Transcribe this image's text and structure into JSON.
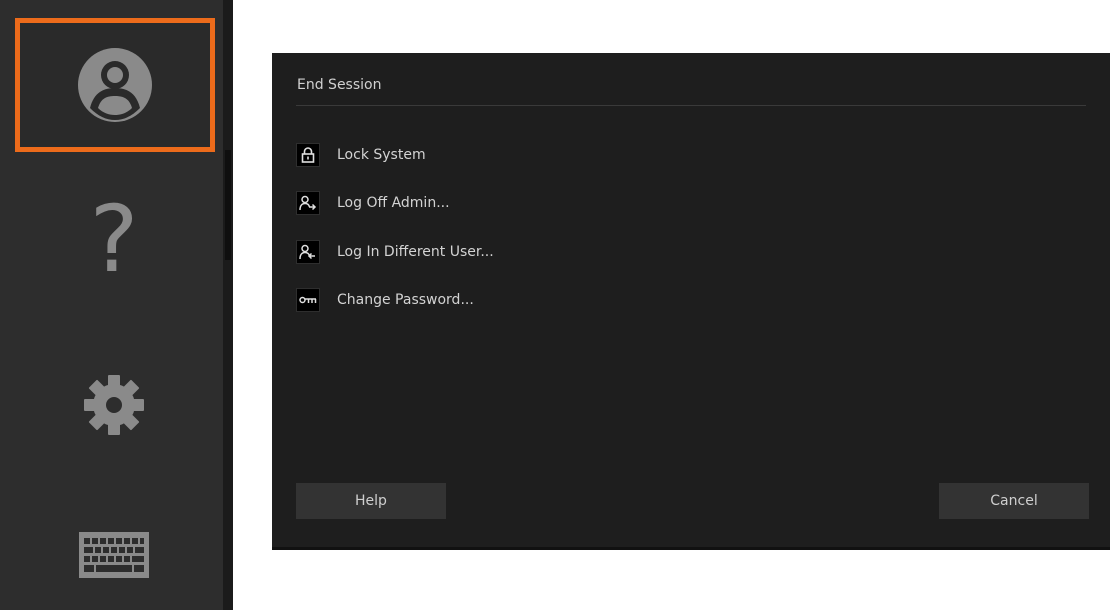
{
  "toolbar": {
    "tools": [
      {
        "icon": "user-icon",
        "selected": true
      },
      {
        "icon": "help-icon",
        "glyph": "?"
      },
      {
        "icon": "gear-icon"
      },
      {
        "icon": "keyboard-icon"
      }
    ],
    "accent_color": "#ec6b1b"
  },
  "dialog": {
    "title": "End Session",
    "items": [
      {
        "label": "Lock System",
        "icon": "lock-icon"
      },
      {
        "label": "Log Off Admin...",
        "icon": "user-logoff-icon"
      },
      {
        "label": "Log In Different User...",
        "icon": "user-login-icon"
      },
      {
        "label": "Change Password...",
        "icon": "key-icon"
      }
    ],
    "help_label": "Help",
    "cancel_label": "Cancel"
  }
}
